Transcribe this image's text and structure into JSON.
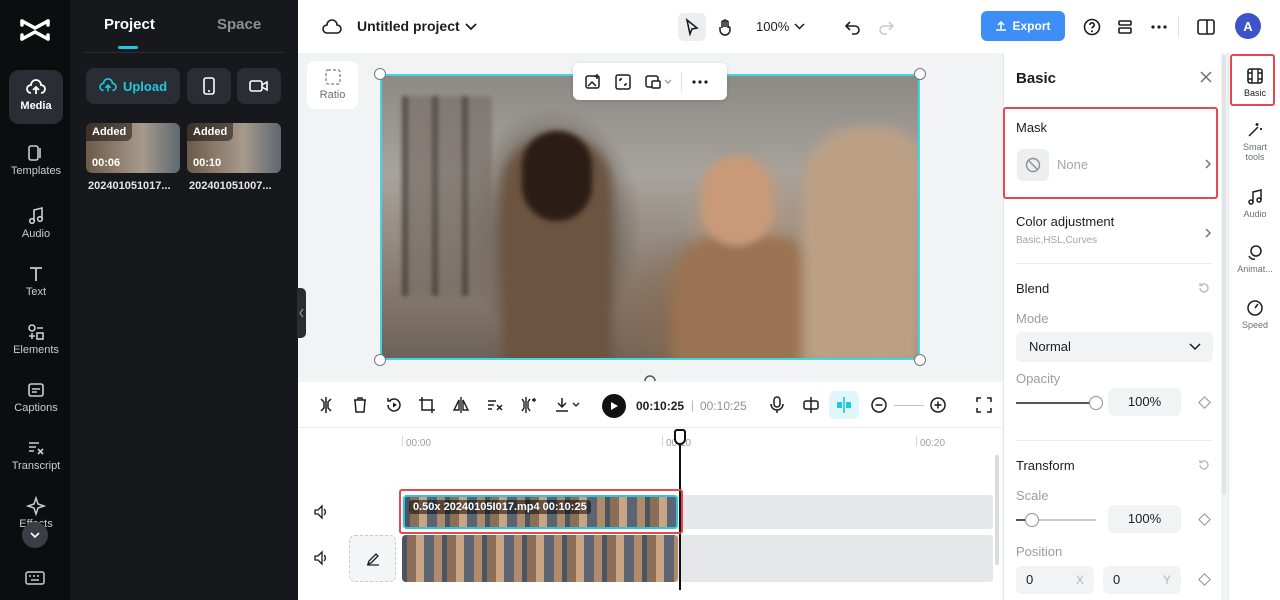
{
  "leftnav": {
    "items": [
      {
        "label": "Media"
      },
      {
        "label": "Templates"
      },
      {
        "label": "Audio"
      },
      {
        "label": "Text"
      },
      {
        "label": "Elements"
      },
      {
        "label": "Captions"
      },
      {
        "label": "Transcript"
      },
      {
        "label": "Effects"
      }
    ]
  },
  "media": {
    "tabs": [
      "Project",
      "Space"
    ],
    "upload_label": "Upload",
    "items": [
      {
        "badge": "Added",
        "duration": "00:06",
        "name": "202401051017..."
      },
      {
        "badge": "Added",
        "duration": "00:10",
        "name": "202401051007..."
      }
    ]
  },
  "topbar": {
    "project_title": "Untitled project",
    "zoom": "100%",
    "export_label": "Export",
    "avatar_initial": "A"
  },
  "canvas": {
    "ratio_label": "Ratio"
  },
  "timeline": {
    "current_time": "00:10:25",
    "separator": "|",
    "total_time": "00:10:25",
    "ruler": [
      "00:00",
      "00:10",
      "00:20"
    ],
    "clip_label": "0.50x  20240105I017.mp4  00:10:25"
  },
  "props": {
    "title": "Basic",
    "mask": {
      "title": "Mask",
      "value": "None"
    },
    "color": {
      "title": "Color adjustment",
      "subtitle": "Basic,HSL,Curves"
    },
    "blend": {
      "title": "Blend",
      "mode_label": "Mode",
      "mode_value": "Normal",
      "opacity_label": "Opacity",
      "opacity_value": "100%",
      "opacity_fraction": 1.0
    },
    "transform": {
      "title": "Transform",
      "scale_label": "Scale",
      "scale_value": "100%",
      "position_label": "Position",
      "pos_x": "0",
      "pos_x_axis": "X",
      "pos_y": "0",
      "pos_y_axis": "Y"
    }
  },
  "rtabs": [
    {
      "label": "Basic"
    },
    {
      "label": "Smart tools"
    },
    {
      "label": "Audio"
    },
    {
      "label": "Animat..."
    },
    {
      "label": "Speed"
    }
  ],
  "colors": {
    "accent": "#1ec9e0",
    "export": "#3e8ef7",
    "highlight": "#e5484d"
  }
}
